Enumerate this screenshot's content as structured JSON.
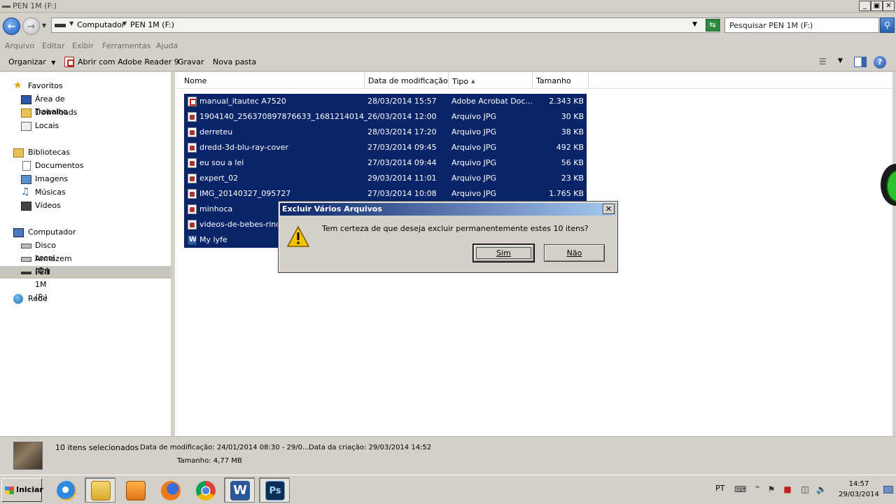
{
  "window": {
    "title": "PEN 1M (F:)",
    "buttons": {
      "minimize": "_",
      "maximize": "▣",
      "close": "✕"
    }
  },
  "address": {
    "crumbs": [
      "Computador",
      "PEN 1M (F:)"
    ],
    "search_placeholder": "Pesquisar PEN 1M (F:)"
  },
  "menu": [
    "Arquivo",
    "Editar",
    "Exibir",
    "Ferramentas",
    "Ajuda"
  ],
  "commands": {
    "organize": "Organizar",
    "open_with": "Abrir com Adobe Reader 9",
    "burn": "Gravar",
    "new_folder": "Nova pasta"
  },
  "nav": {
    "favorites": "Favoritos",
    "desktop": "Área de Trabalho",
    "downloads": "Downloads",
    "places": "Locais",
    "libraries": "Bibliotecas",
    "documents": "Documentos",
    "images": "Imagens",
    "music": "Músicas",
    "videos": "Vídeos",
    "computer": "Computador",
    "local_disk": "Disco Local (C:)",
    "storage": "Armazem (D:)",
    "pen": "PEN 1M (F:)",
    "network": "Rede"
  },
  "columns": {
    "name": "Nome",
    "modified": "Data de modificação",
    "type": "Tipo",
    "size": "Tamanho"
  },
  "files": [
    {
      "name": "manual_itautec A7520",
      "modified": "28/03/2014 15:57",
      "type": "Adobe Acrobat Doc...",
      "size": "2.343 KB",
      "icon": "pdf-icon"
    },
    {
      "name": "1904140_256370897876633_1681214014_n",
      "modified": "26/03/2014 12:00",
      "type": "Arquivo JPG",
      "size": "30 KB",
      "icon": "jpg-icon"
    },
    {
      "name": "derreteu",
      "modified": "28/03/2014 17:20",
      "type": "Arquivo JPG",
      "size": "38 KB",
      "icon": "jpg-icon"
    },
    {
      "name": "dredd-3d-blu-ray-cover",
      "modified": "27/03/2014 09:45",
      "type": "Arquivo JPG",
      "size": "492 KB",
      "icon": "jpg-icon"
    },
    {
      "name": "eu sou a lei",
      "modified": "27/03/2014 09:44",
      "type": "Arquivo JPG",
      "size": "56 KB",
      "icon": "jpg-icon"
    },
    {
      "name": "expert_02",
      "modified": "29/03/2014 11:01",
      "type": "Arquivo JPG",
      "size": "23 KB",
      "icon": "jpg-icon"
    },
    {
      "name": "IMG_20140327_095727",
      "modified": "27/03/2014 10:08",
      "type": "Arquivo JPG",
      "size": "1.765 KB",
      "icon": "jpg-icon"
    },
    {
      "name": "minhoca",
      "modified": "",
      "type": "",
      "size": "",
      "icon": "jpg-icon"
    },
    {
      "name": "videos-de-bebes-rindo",
      "modified": "",
      "type": "",
      "size": "",
      "icon": "jpg-icon"
    },
    {
      "name": "My lyfe",
      "modified": "",
      "type": "",
      "size": "",
      "icon": "word-doc-icon"
    }
  ],
  "dialog": {
    "title": "Excluir Vários Arquivos",
    "close": "✕",
    "message": "Tem certeza de que deseja excluir permanentemente estes 10 itens?",
    "yes": "Sim",
    "no": "Não"
  },
  "details": {
    "count": "10 itens selecionados",
    "modified": "Data de modificação: 24/01/2014 08:30 - 29/0...",
    "created": "Data da criação: 29/03/2014 14:52",
    "size": "Tamanho: 4,77 MB"
  },
  "taskbar": {
    "start": "Iniciar",
    "apps": [
      "internet-explorer-icon",
      "windows-explorer-icon",
      "media-player-icon",
      "firefox-icon",
      "chrome-icon",
      "word-icon",
      "photoshop-icon"
    ],
    "lang": "PT",
    "time": "14:57",
    "date": "29/03/2014"
  },
  "colors": {
    "selection": "#0a246a",
    "dialog_title_start": "#0a246a",
    "dialog_title_end": "#a6caf0",
    "chrome": "#d4d0c8"
  }
}
